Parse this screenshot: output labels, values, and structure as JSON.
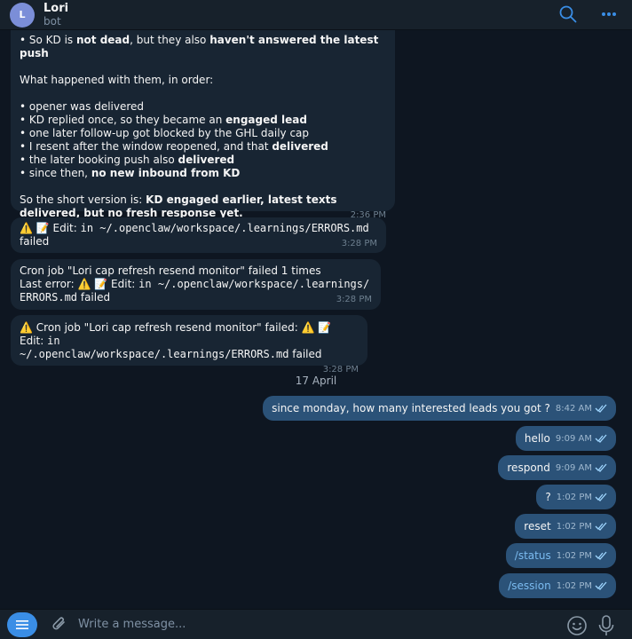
{
  "header": {
    "avatar_letter": "L",
    "name": "Lori",
    "subtitle": "bot"
  },
  "summary_message": {
    "line1_a": "• So KD is ",
    "line1_b": "not dead",
    "line1_c": ", but they also ",
    "line1_d": "haven't answered the latest push",
    "what_happened": "What happened with them, in order:",
    "b1": "• opener was delivered",
    "b2_a": "• KD replied once, so they became an ",
    "b2_b": "engaged lead",
    "b3": "• one later follow-up got blocked by the GHL daily cap",
    "b4_a": "• I resent after the window reopened, and that ",
    "b4_b": "delivered",
    "b5_a": "• the later booking push also ",
    "b5_b": "delivered",
    "b6_a": "• since then, ",
    "b6_b": "no new inbound from KD",
    "short_a": "So the short version is: ",
    "short_b": "KD engaged earlier, latest texts delivered, but no fresh response yet.",
    "time": "2:36 PM"
  },
  "error_msg_1": {
    "emoji": "⚠️ 📝",
    "text_a": " Edit: ",
    "mono": "in ~/.openclaw/workspace/.learnings/ERRORS.md",
    "text_b": "failed",
    "time": "3:28 PM"
  },
  "error_msg_2": {
    "line1": "Cron job \"Lori cap refresh resend monitor\" failed 1 times",
    "line2_a": "Last error: ",
    "emoji": "⚠️ 📝",
    "line2_b": " Edit: ",
    "mono_a": "in ~/.openclaw/workspace/.learnings/",
    "mono_b": "ERRORS.md",
    "tail": " failed",
    "time": "3:28 PM"
  },
  "error_msg_3": {
    "emoji1": "⚠️",
    "line1": " Cron job \"Lori cap refresh resend monitor\" failed: ",
    "emoji2": "⚠️ 📝",
    "edit": " Edit: ",
    "mono_a": "in",
    "mono_b": "~/.openclaw/workspace/.learnings/ERRORS.md",
    "tail": " failed",
    "time": "3:28 PM"
  },
  "date_separator": "17 April",
  "outgoing": [
    {
      "text": "since monday, how many interested leads you got ?",
      "time": "8:42 AM"
    },
    {
      "text": "hello",
      "time": "9:09 AM"
    },
    {
      "text": "respond",
      "time": "9:09 AM"
    },
    {
      "text": "?",
      "time": "1:02 PM"
    },
    {
      "text": "reset",
      "time": "1:02 PM"
    },
    {
      "text": "/status",
      "time": "1:02 PM"
    },
    {
      "text": "/session",
      "time": "1:02 PM"
    }
  ],
  "composer": {
    "placeholder": "Write a message..."
  },
  "colors": {
    "background": "#0e1621",
    "incoming_bubble": "#182533",
    "outgoing_bubble": "#2b5278",
    "accent": "#3a8ee6"
  },
  "icons": [
    "search-icon",
    "more-icon",
    "menu-icon",
    "attach-icon",
    "emoji-icon",
    "mic-icon",
    "double-check-icon"
  ]
}
